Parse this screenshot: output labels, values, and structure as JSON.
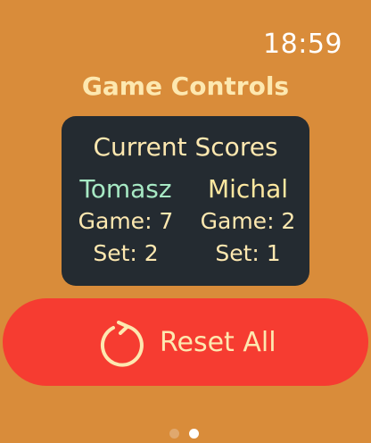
{
  "status_bar": {
    "time": "18:59"
  },
  "page": {
    "title": "Game Controls"
  },
  "scores": {
    "heading": "Current Scores",
    "players": [
      {
        "name": "Tomasz",
        "game_text": "Game: 7",
        "set_text": "Set: 2",
        "name_color": "#a7e9c4"
      },
      {
        "name": "Michal",
        "game_text": "Game: 2",
        "set_text": "Set: 1",
        "name_color": "#fde8a0"
      }
    ]
  },
  "reset": {
    "label": "Reset All",
    "icon": "reset-icon",
    "color": "#f63c31"
  },
  "pagination": {
    "current_page": 2,
    "total_pages": 2
  },
  "theme": {
    "background": "#d98c3a",
    "card": "#242b31",
    "text": "#fde8b0"
  }
}
